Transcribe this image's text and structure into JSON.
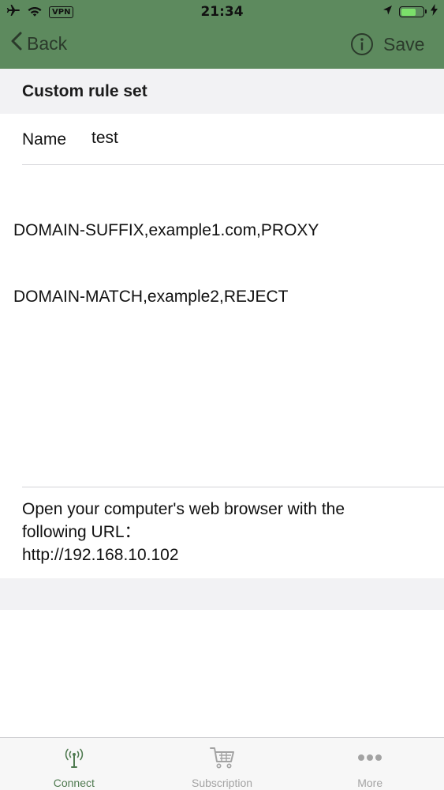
{
  "status_bar": {
    "time": "21:34",
    "vpn_label": "VPN",
    "battery_level": 0.7
  },
  "nav": {
    "back_label": "Back",
    "save_label": "Save"
  },
  "section": {
    "title": "Custom rule set"
  },
  "name_field": {
    "label": "Name",
    "value": "test"
  },
  "rules": [
    "DOMAIN-SUFFIX,example1.com,PROXY",
    "DOMAIN-MATCH,example2,REJECT"
  ],
  "hint": {
    "line1": "Open your computer's web browser with the",
    "line2": "following URL：",
    "url": "http://192.168.10.102"
  },
  "tabs": [
    {
      "label": "Connect",
      "icon": "antenna-icon",
      "active": true
    },
    {
      "label": "Subscription",
      "icon": "cart-icon",
      "active": false
    },
    {
      "label": "More",
      "icon": "more-dots-icon",
      "active": false
    }
  ],
  "colors": {
    "nav_background": "#5d8a5e",
    "active_tab": "#4f7a50",
    "inactive_tab": "#a3a3a3",
    "section_background": "#f2f2f4"
  }
}
